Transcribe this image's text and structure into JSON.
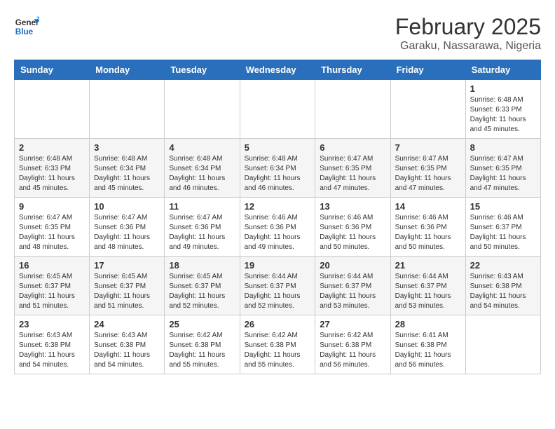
{
  "logo": {
    "line1": "General",
    "line2": "Blue"
  },
  "title": "February 2025",
  "subtitle": "Garaku, Nassarawa, Nigeria",
  "weekdays": [
    "Sunday",
    "Monday",
    "Tuesday",
    "Wednesday",
    "Thursday",
    "Friday",
    "Saturday"
  ],
  "weeks": [
    [
      {
        "day": "",
        "info": ""
      },
      {
        "day": "",
        "info": ""
      },
      {
        "day": "",
        "info": ""
      },
      {
        "day": "",
        "info": ""
      },
      {
        "day": "",
        "info": ""
      },
      {
        "day": "",
        "info": ""
      },
      {
        "day": "1",
        "info": "Sunrise: 6:48 AM\nSunset: 6:33 PM\nDaylight: 11 hours\nand 45 minutes."
      }
    ],
    [
      {
        "day": "2",
        "info": "Sunrise: 6:48 AM\nSunset: 6:33 PM\nDaylight: 11 hours\nand 45 minutes."
      },
      {
        "day": "3",
        "info": "Sunrise: 6:48 AM\nSunset: 6:34 PM\nDaylight: 11 hours\nand 45 minutes."
      },
      {
        "day": "4",
        "info": "Sunrise: 6:48 AM\nSunset: 6:34 PM\nDaylight: 11 hours\nand 46 minutes."
      },
      {
        "day": "5",
        "info": "Sunrise: 6:48 AM\nSunset: 6:34 PM\nDaylight: 11 hours\nand 46 minutes."
      },
      {
        "day": "6",
        "info": "Sunrise: 6:47 AM\nSunset: 6:35 PM\nDaylight: 11 hours\nand 47 minutes."
      },
      {
        "day": "7",
        "info": "Sunrise: 6:47 AM\nSunset: 6:35 PM\nDaylight: 11 hours\nand 47 minutes."
      },
      {
        "day": "8",
        "info": "Sunrise: 6:47 AM\nSunset: 6:35 PM\nDaylight: 11 hours\nand 47 minutes."
      }
    ],
    [
      {
        "day": "9",
        "info": "Sunrise: 6:47 AM\nSunset: 6:35 PM\nDaylight: 11 hours\nand 48 minutes."
      },
      {
        "day": "10",
        "info": "Sunrise: 6:47 AM\nSunset: 6:36 PM\nDaylight: 11 hours\nand 48 minutes."
      },
      {
        "day": "11",
        "info": "Sunrise: 6:47 AM\nSunset: 6:36 PM\nDaylight: 11 hours\nand 49 minutes."
      },
      {
        "day": "12",
        "info": "Sunrise: 6:46 AM\nSunset: 6:36 PM\nDaylight: 11 hours\nand 49 minutes."
      },
      {
        "day": "13",
        "info": "Sunrise: 6:46 AM\nSunset: 6:36 PM\nDaylight: 11 hours\nand 50 minutes."
      },
      {
        "day": "14",
        "info": "Sunrise: 6:46 AM\nSunset: 6:36 PM\nDaylight: 11 hours\nand 50 minutes."
      },
      {
        "day": "15",
        "info": "Sunrise: 6:46 AM\nSunset: 6:37 PM\nDaylight: 11 hours\nand 50 minutes."
      }
    ],
    [
      {
        "day": "16",
        "info": "Sunrise: 6:45 AM\nSunset: 6:37 PM\nDaylight: 11 hours\nand 51 minutes."
      },
      {
        "day": "17",
        "info": "Sunrise: 6:45 AM\nSunset: 6:37 PM\nDaylight: 11 hours\nand 51 minutes."
      },
      {
        "day": "18",
        "info": "Sunrise: 6:45 AM\nSunset: 6:37 PM\nDaylight: 11 hours\nand 52 minutes."
      },
      {
        "day": "19",
        "info": "Sunrise: 6:44 AM\nSunset: 6:37 PM\nDaylight: 11 hours\nand 52 minutes."
      },
      {
        "day": "20",
        "info": "Sunrise: 6:44 AM\nSunset: 6:37 PM\nDaylight: 11 hours\nand 53 minutes."
      },
      {
        "day": "21",
        "info": "Sunrise: 6:44 AM\nSunset: 6:37 PM\nDaylight: 11 hours\nand 53 minutes."
      },
      {
        "day": "22",
        "info": "Sunrise: 6:43 AM\nSunset: 6:38 PM\nDaylight: 11 hours\nand 54 minutes."
      }
    ],
    [
      {
        "day": "23",
        "info": "Sunrise: 6:43 AM\nSunset: 6:38 PM\nDaylight: 11 hours\nand 54 minutes."
      },
      {
        "day": "24",
        "info": "Sunrise: 6:43 AM\nSunset: 6:38 PM\nDaylight: 11 hours\nand 54 minutes."
      },
      {
        "day": "25",
        "info": "Sunrise: 6:42 AM\nSunset: 6:38 PM\nDaylight: 11 hours\nand 55 minutes."
      },
      {
        "day": "26",
        "info": "Sunrise: 6:42 AM\nSunset: 6:38 PM\nDaylight: 11 hours\nand 55 minutes."
      },
      {
        "day": "27",
        "info": "Sunrise: 6:42 AM\nSunset: 6:38 PM\nDaylight: 11 hours\nand 56 minutes."
      },
      {
        "day": "28",
        "info": "Sunrise: 6:41 AM\nSunset: 6:38 PM\nDaylight: 11 hours\nand 56 minutes."
      },
      {
        "day": "",
        "info": ""
      }
    ]
  ]
}
